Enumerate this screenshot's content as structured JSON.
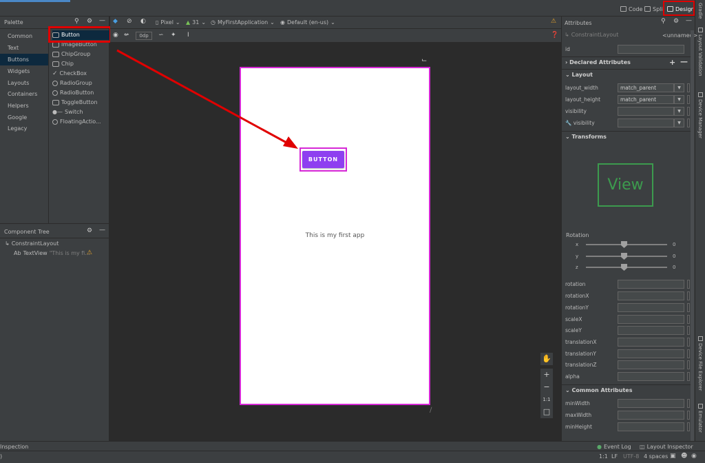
{
  "topbar": {
    "code_label": "Code",
    "split_label": "Spli",
    "design_label": "Design"
  },
  "right_strip": [
    "Gradle",
    "Layout Validation",
    "Device Manager",
    "Device File Explorer",
    "Emulator"
  ],
  "palette": {
    "title": "Palette",
    "categories": [
      "Common",
      "Text",
      "Buttons",
      "Widgets",
      "Layouts",
      "Containers",
      "Helpers",
      "Google",
      "Legacy"
    ],
    "selected_category": "Buttons",
    "items": [
      "Button",
      "ImageButton",
      "ChipGroup",
      "Chip",
      "CheckBox",
      "RadioGroup",
      "RadioButton",
      "ToggleButton",
      "Switch",
      "FloatingActio..."
    ]
  },
  "design_toolbar": {
    "device": "Pixel",
    "api": "31",
    "app": "MyFirstApplication",
    "locale": "Default (en-us)",
    "margin": "0dp"
  },
  "component_tree": {
    "title": "Component Tree",
    "root": "ConstraintLayout",
    "child_prefix": "Ab",
    "child": "TextView",
    "child_text": "\"This is my fi..."
  },
  "preview": {
    "button_text": "BUTTON",
    "textview_text": "This is my first app",
    "zoom_fit": "1:1"
  },
  "attributes": {
    "title": "Attributes",
    "widget": "ConstraintLayout",
    "widget_id": "<unnamed>",
    "id_label": "id",
    "declared_section": "Declared Attributes",
    "layout_section": "Layout",
    "layout_width_label": "layout_width",
    "layout_width_value": "match_parent",
    "layout_height_label": "layout_height",
    "layout_height_value": "match_parent",
    "visibility_label": "visibility",
    "tools_visibility_label": "visibility",
    "transforms_section": "Transforms",
    "view_label": "View",
    "rotation_label": "Rotation",
    "rot_x": "x",
    "rot_y": "y",
    "rot_z": "z",
    "rot_x_val": "0",
    "rot_y_val": "0",
    "rot_z_val": "0",
    "fields": [
      "rotation",
      "rotationX",
      "rotationY",
      "scaleX",
      "scaleY",
      "translationX",
      "translationY",
      "translationZ",
      "alpha"
    ],
    "common_section": "Common Attributes",
    "common_fields": [
      "minWidth",
      "maxWidth",
      "minHeight"
    ]
  },
  "bottom": {
    "inspection": "Inspection",
    "event_log": "Event Log",
    "layout_inspector": "Layout Inspector",
    "position": "1:1",
    "line_sep": "LF",
    "encoding": "UTF-8",
    "indent": "4 spaces"
  },
  "colors": {
    "highlight_red": "#e00000",
    "button_purple": "#8e3ff0",
    "selection_magenta": "#d627d6",
    "view_green": "#3c9b4e"
  }
}
